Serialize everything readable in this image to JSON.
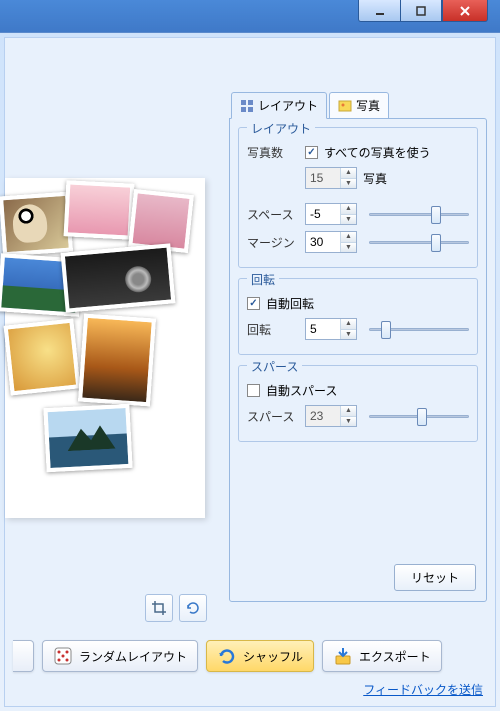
{
  "tabs": {
    "layout": "レイアウト",
    "photos": "写真"
  },
  "layout_section": {
    "legend": "レイアウト",
    "photo_count_label": "写真数",
    "use_all_label": "すべての写真を使う",
    "use_all_checked": true,
    "photo_count_value": "15",
    "photo_unit": "写真",
    "space_label": "スペース",
    "space_value": "-5",
    "margin_label": "マージン",
    "margin_value": "30"
  },
  "rotation_section": {
    "legend": "回転",
    "auto_label": "自動回転",
    "auto_checked": true,
    "rotation_label": "回転",
    "rotation_value": "5"
  },
  "sparse_section": {
    "legend": "スパース",
    "auto_label": "自動スパース",
    "auto_checked": false,
    "sparse_label": "スパース",
    "sparse_value": "23"
  },
  "buttons": {
    "reset": "リセット",
    "random_layout": "ランダムレイアウト",
    "shuffle": "シャッフル",
    "export": "エクスポート"
  },
  "feedback": "フィードバックを送信"
}
